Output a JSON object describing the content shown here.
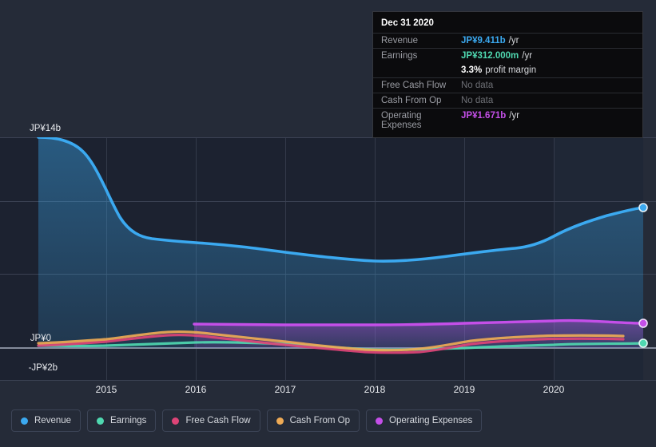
{
  "chart_data": {
    "type": "area",
    "title": "",
    "xlabel": "",
    "ylabel": "",
    "currency": "JP¥",
    "grid": true,
    "legend_position": "bottom",
    "ylim": [
      -2,
      14
    ],
    "y_ticks": [
      {
        "label": "JP¥14b",
        "value": 14
      },
      {
        "label": "JP¥0",
        "value": 0
      },
      {
        "label": "-JP¥2b",
        "value": -2
      }
    ],
    "x_ticks": [
      "2015",
      "2016",
      "2017",
      "2018",
      "2019",
      "2020"
    ],
    "xlim": [
      "2014.3",
      "2020.9"
    ],
    "forecast_region_start": "2020",
    "series": [
      {
        "name": "Revenue",
        "color": "#3ba9f0",
        "end_value": 9.411,
        "x": [
          2014.35,
          2014.6,
          2014.9,
          2015.1,
          2015.35,
          2015.6,
          2015.85,
          2016.1,
          2016.4,
          2016.7,
          2017.0,
          2017.35,
          2017.65,
          2018.0,
          2018.3,
          2018.6,
          2018.9,
          2019.2,
          2019.5,
          2019.8,
          2020.1,
          2020.45,
          2020.75
        ],
        "values": [
          14.0,
          13.85,
          12.4,
          10.2,
          8.75,
          8.5,
          8.35,
          8.3,
          8.25,
          8.15,
          7.9,
          7.6,
          7.45,
          7.4,
          7.5,
          7.55,
          7.7,
          7.95,
          8.1,
          8.15,
          8.65,
          9.1,
          9.411
        ]
      },
      {
        "name": "Earnings",
        "color": "#4fd8b0",
        "end_value": 0.312,
        "x": [
          2014.35,
          2015.0,
          2015.7,
          2016.3,
          2017.0,
          2017.7,
          2018.3,
          2019.0,
          2019.6,
          2020.2,
          2020.75
        ],
        "values": [
          0.08,
          0.07,
          0.1,
          0.13,
          0.1,
          -0.02,
          -0.08,
          0.0,
          0.06,
          0.2,
          0.312
        ]
      },
      {
        "name": "Free Cash Flow",
        "color": "#dd4477",
        "end_value": null,
        "end_label": "No data",
        "x": [
          2014.35,
          2015.0,
          2015.6,
          2016.0,
          2016.5,
          2017.1,
          2017.7,
          2018.3,
          2018.9,
          2019.4,
          2020.0,
          2020.6
        ],
        "values": [
          0.1,
          0.15,
          0.45,
          0.6,
          0.5,
          0.25,
          0.05,
          -0.15,
          -0.2,
          0.15,
          0.5,
          0.55
        ]
      },
      {
        "name": "Cash From Op",
        "color": "#eeaa55",
        "end_value": null,
        "end_label": "No data",
        "x": [
          2014.35,
          2015.0,
          2015.6,
          2016.0,
          2016.5,
          2017.1,
          2017.7,
          2018.3,
          2018.9,
          2019.4,
          2020.0,
          2020.6
        ],
        "values": [
          0.25,
          0.3,
          0.62,
          0.78,
          0.7,
          0.45,
          0.2,
          0.0,
          -0.05,
          0.35,
          0.68,
          0.72
        ]
      },
      {
        "name": "Operating Expenses",
        "color": "#c44fe8",
        "end_value": 1.671,
        "x": [
          2015.85,
          2016.4,
          2017.0,
          2017.6,
          2018.2,
          2018.8,
          2019.4,
          2020.0,
          2020.75
        ],
        "values": [
          1.52,
          1.5,
          1.5,
          1.5,
          1.5,
          1.52,
          1.55,
          1.62,
          1.671
        ]
      }
    ]
  },
  "tooltip": {
    "title": "Dec 31 2020",
    "rows": [
      {
        "label": "Revenue",
        "value": "JP¥9.411b",
        "unit": "/yr",
        "value_color": "#3ba9f0",
        "no_data": false
      },
      {
        "label": "Earnings",
        "value": "JP¥312.000m",
        "unit": "/yr",
        "value_color": "#4fd8b0",
        "no_data": false
      },
      {
        "label": "Free Cash Flow",
        "value": "No data",
        "unit": "",
        "value_color": "#6e7076",
        "no_data": true
      },
      {
        "label": "Cash From Op",
        "value": "No data",
        "unit": "",
        "value_color": "#6e7076",
        "no_data": true
      },
      {
        "label": "Operating Expenses",
        "value": "JP¥1.671b",
        "unit": "/yr",
        "value_color": "#c44fe8",
        "no_data": false
      }
    ],
    "profit_margin_value": "3.3%",
    "profit_margin_label": "profit margin"
  },
  "legend": {
    "items": [
      {
        "label": "Revenue",
        "color": "#3ba9f0"
      },
      {
        "label": "Earnings",
        "color": "#4fd8b0"
      },
      {
        "label": "Free Cash Flow",
        "color": "#dd4477"
      },
      {
        "label": "Cash From Op",
        "color": "#eeaa55"
      },
      {
        "label": "Operating Expenses",
        "color": "#c44fe8"
      }
    ]
  },
  "axis": {
    "y_labels": [
      "JP¥14b",
      "JP¥0",
      "-JP¥2b"
    ],
    "x_labels": [
      "2015",
      "2016",
      "2017",
      "2018",
      "2019",
      "2020"
    ]
  }
}
